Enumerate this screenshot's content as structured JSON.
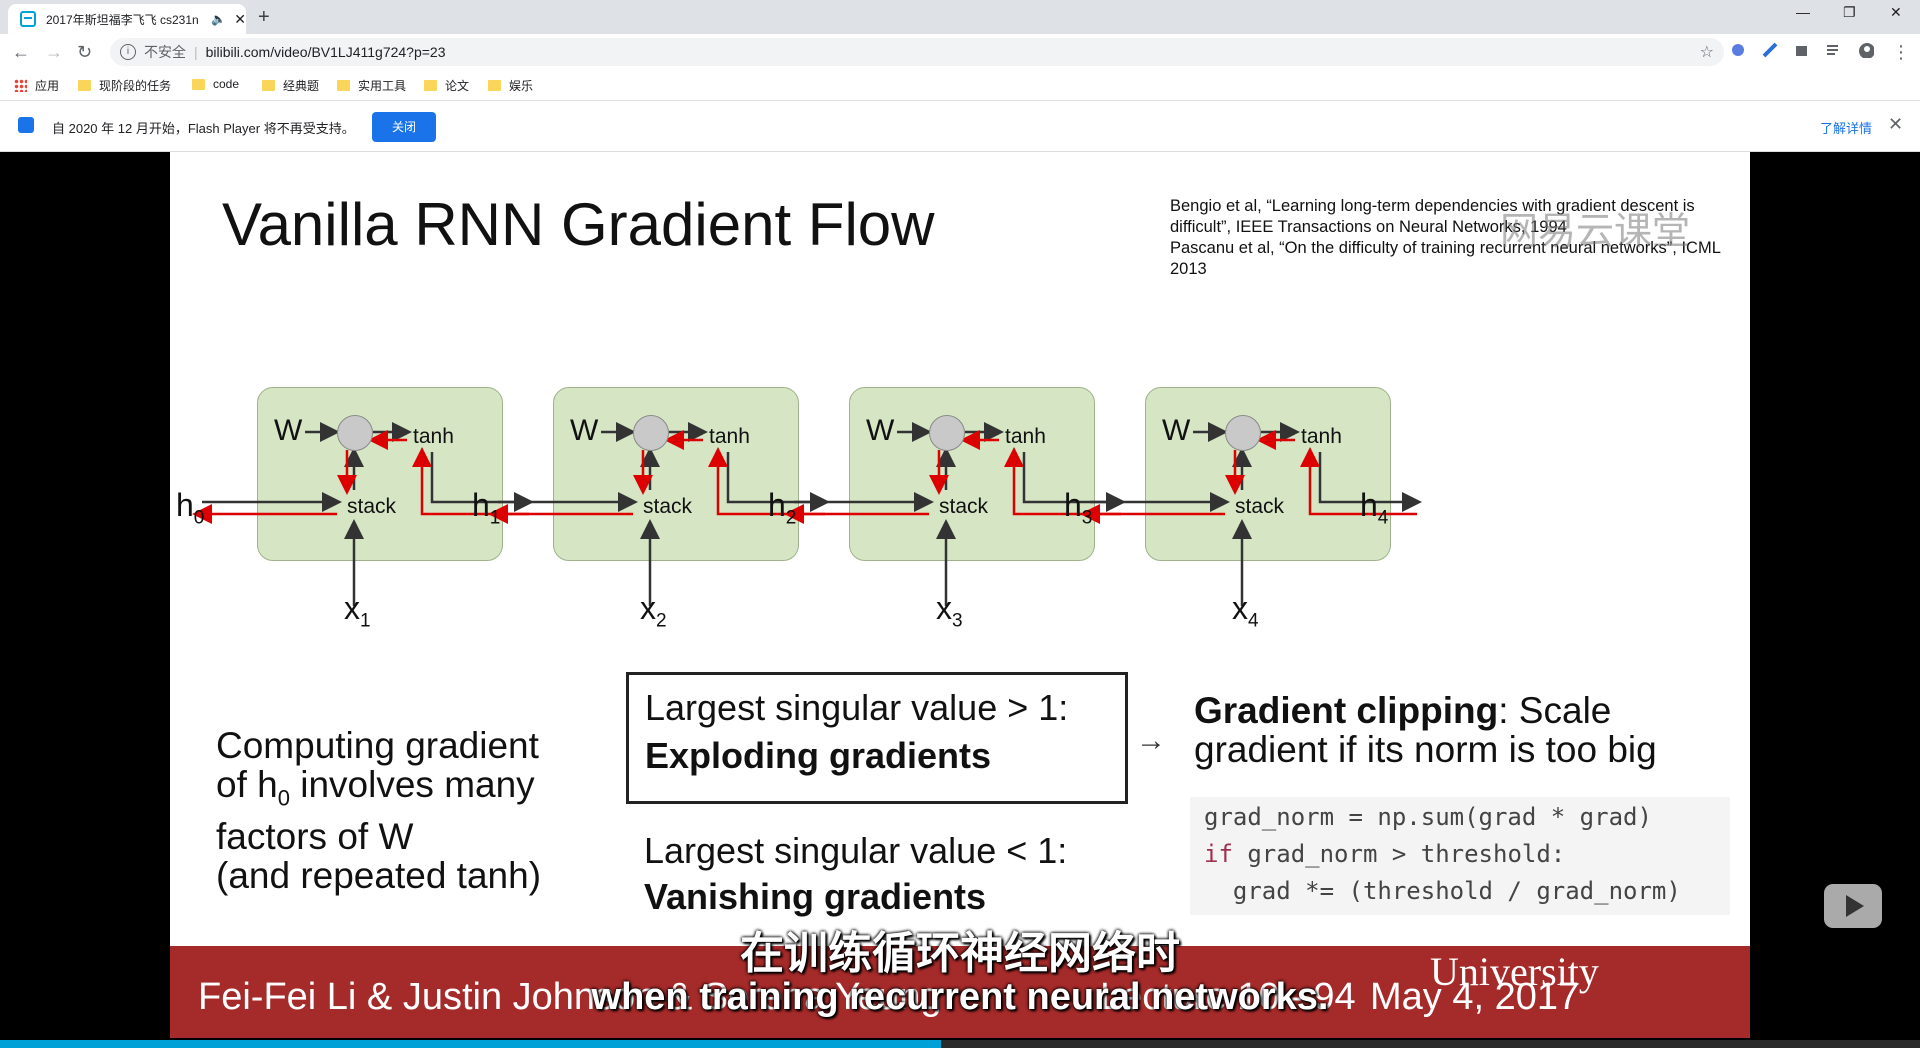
{
  "browser": {
    "tab_title": "2017年斯坦福李飞飞 cs231n",
    "address_security": "不安全",
    "url": "bilibili.com/video/BV1LJ411g724?p=23",
    "bookmarks": [
      "应用",
      "现阶段的任务",
      "code",
      "经典题",
      "实用工具",
      "论文",
      "娱乐"
    ],
    "infobar_message": "自 2020 年 12 月开始，Flash Player 将不再受支持。",
    "infobar_close": "关闭",
    "infobar_learn_more": "了解详情"
  },
  "slide": {
    "title": "Vanilla RNN Gradient Flow",
    "refs": [
      "Bengio et al, “Learning long-term dependencies with gradient descent is difficult”, IEEE Transactions on Neural Networks, 1994",
      "Pascanu et al, “On the difficulty of training recurrent neural networks”, ICML 2013"
    ],
    "watermark": "网易云课堂",
    "cell_labels": {
      "w": "W",
      "tanh": "tanh",
      "stack": "stack"
    },
    "h_labels": [
      "h",
      "h",
      "h",
      "h",
      "h"
    ],
    "h_subs": [
      "0",
      "1",
      "2",
      "3",
      "4"
    ],
    "x_labels": [
      "x",
      "x",
      "x",
      "x"
    ],
    "x_subs": [
      "1",
      "2",
      "3",
      "4"
    ],
    "left_note": {
      "line1": "Computing gradient",
      "line2a": "of h",
      "line2sub": "0",
      "line2b": " involves many",
      "line3": "factors of W",
      "line4": "(and repeated tanh)"
    },
    "explode": {
      "line1": "Largest singular value > 1:",
      "line2": "Exploding gradients"
    },
    "vanish": {
      "line1": "Largest singular value < 1:",
      "line2": "Vanishing gradients"
    },
    "clip": {
      "bold": "Gradient clipping",
      "rest": ": Scale",
      "line2": "gradient if its norm is too big"
    },
    "code": [
      "grad_norm = np.sum(grad * grad)",
      "threshold:",
      "  grad *= (threshold / grad_norm)"
    ],
    "code_kw": "if",
    "code_l2_prefix": " grad_norm > ",
    "footer": {
      "authors": "Fei-Fei Li & Justin Johnson & Serena Yeung",
      "lecture": "Lecture 10 -",
      "slide_no": "94",
      "date": "May 4, 2017",
      "university": "University"
    }
  },
  "subtitles": {
    "zh": "在训练循环神经网络时",
    "en": "when training recurrent neural networks."
  },
  "player": {
    "progress_fraction": 0.49
  }
}
